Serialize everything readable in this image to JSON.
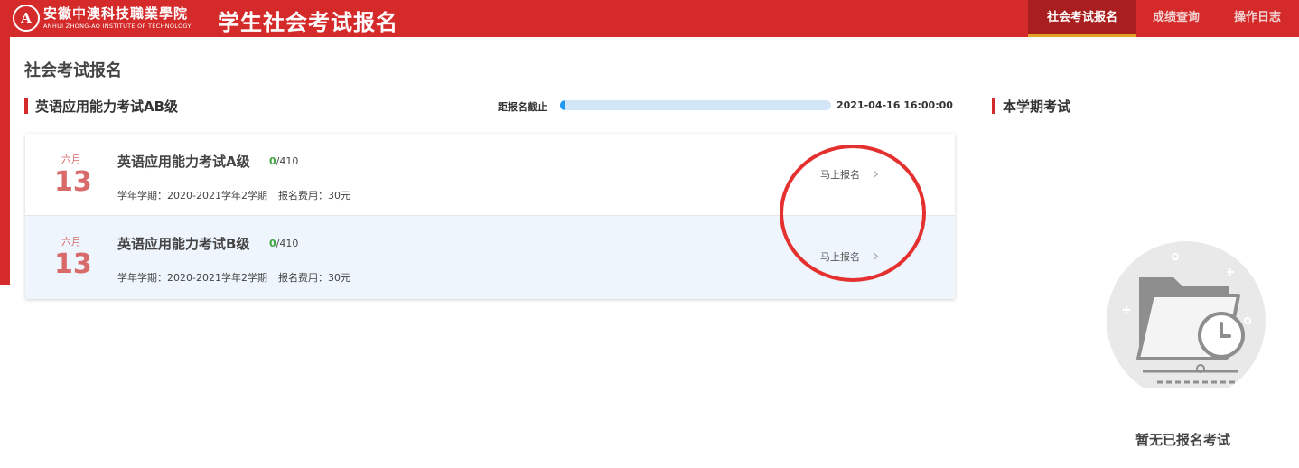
{
  "header": {
    "logo": {
      "seal_letter": "A",
      "name_cn": "安徽中澳科技職業學院",
      "name_en": "ANHUI ZHONG-AO INSTITUTE OF TECHNOLOGY"
    },
    "system_title": "学生社会考试报名",
    "nav": [
      {
        "label": "社会考试报名",
        "active": true
      },
      {
        "label": "成绩查询",
        "active": false
      },
      {
        "label": "操作日志",
        "active": false
      }
    ]
  },
  "page_title": "社会考试报名",
  "exam_group": {
    "title": "英语应用能力考试AB级",
    "deadline_label": "距报名截止",
    "deadline_progress": 0.02,
    "deadline_time": "2021-04-16 16:00:00",
    "items": [
      {
        "month": "六月",
        "day": "13",
        "title": "英语应用能力考试A级",
        "enrolled": "0",
        "capacity": "/410",
        "term": "学年学期：2020-2021学年2学期",
        "fee": "报名费用：30元",
        "action": "马上报名"
      },
      {
        "month": "六月",
        "day": "13",
        "title": "英语应用能力考试B级",
        "enrolled": "0",
        "capacity": "/410",
        "term": "学年学期：2020-2021学年2学期",
        "fee": "报名费用：30元",
        "action": "马上报名"
      }
    ]
  },
  "semester": {
    "title": "本学期考试",
    "empty_text": "暂无已报名考试"
  },
  "colors": {
    "brand_red": "#d42a2a",
    "nav_active_bg": "#a91f1f",
    "nav_active_underline": "#e3a32b",
    "date_color": "#d86a6a",
    "count_green": "#3fa33f",
    "progress_fill": "#2196f3",
    "progress_track": "#d3e6f8",
    "annotation_circle": "#e53030"
  }
}
